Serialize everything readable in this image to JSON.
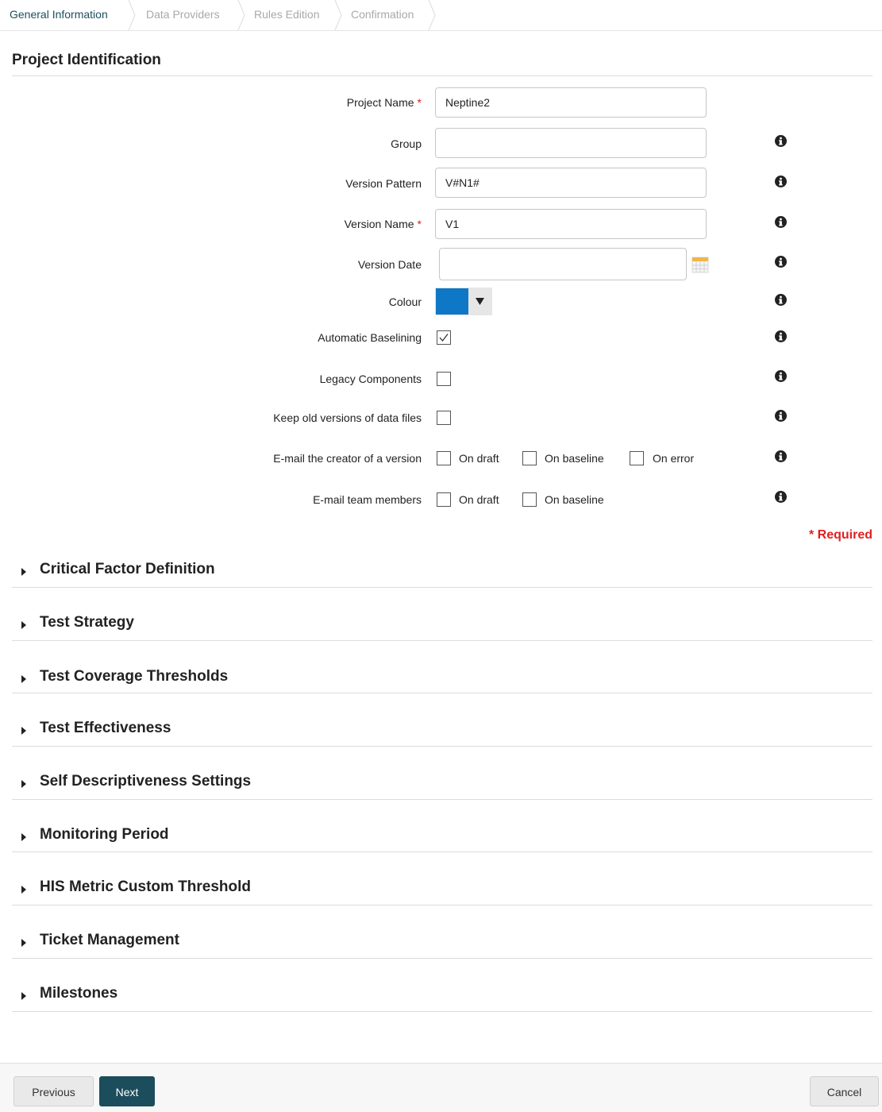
{
  "wizard": {
    "steps": [
      {
        "label": "General Information",
        "active": true
      },
      {
        "label": "Data Providers",
        "active": false
      },
      {
        "label": "Rules Edition",
        "active": false
      },
      {
        "label": "Confirmation",
        "active": false
      }
    ]
  },
  "section": {
    "title": "Project Identification"
  },
  "form": {
    "project_name": {
      "label": "Project Name",
      "value": "Neptine2",
      "required_mark": "*"
    },
    "group": {
      "label": "Group",
      "value": ""
    },
    "version_pattern": {
      "label": "Version Pattern",
      "value": "V#N1#"
    },
    "version_name": {
      "label": "Version Name",
      "value": "V1",
      "required_mark": "*"
    },
    "version_date": {
      "label": "Version Date",
      "value": ""
    },
    "colour": {
      "label": "Colour",
      "value": "#0f78c6"
    },
    "automatic_baselining": {
      "label": "Automatic Baselining",
      "checked": true
    },
    "legacy_components": {
      "label": "Legacy Components",
      "checked": false
    },
    "keep_old_versions": {
      "label": "Keep old versions of data files",
      "checked": false
    },
    "email_creator": {
      "label": "E-mail the creator of a version",
      "options": [
        {
          "label": "On draft",
          "checked": false
        },
        {
          "label": "On baseline",
          "checked": false
        },
        {
          "label": "On error",
          "checked": false
        }
      ]
    },
    "email_team": {
      "label": "E-mail team members",
      "options": [
        {
          "label": "On draft",
          "checked": false
        },
        {
          "label": "On baseline",
          "checked": false
        }
      ]
    },
    "required_note": "* Required"
  },
  "collapsibles": [
    "Critical Factor Definition",
    "Test Strategy",
    "Test Coverage Thresholds",
    "Test Effectiveness",
    "Self Descriptiveness Settings",
    "Monitoring Period",
    "HIS Metric Custom Threshold",
    "Ticket Management",
    "Milestones"
  ],
  "footer": {
    "previous": "Previous",
    "next": "Next",
    "cancel": "Cancel"
  },
  "colors": {
    "primary": "#1c4d5c",
    "required": "#e02020",
    "colour_swatch": "#0f78c6"
  },
  "icons": {
    "info": "info-icon",
    "calendar": "calendar-icon",
    "dropdown": "caret-down-icon",
    "checkmark": "check-icon",
    "section_toggle": "caret-right-icon"
  }
}
